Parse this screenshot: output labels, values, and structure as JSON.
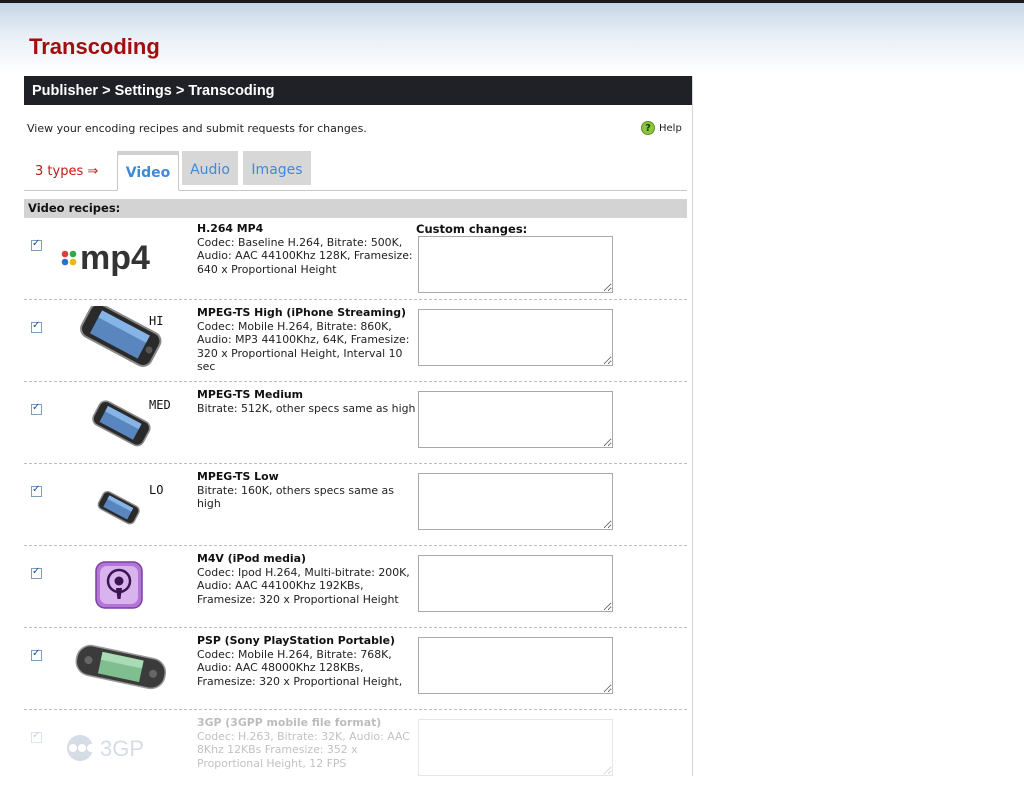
{
  "page": {
    "title": "Transcoding",
    "breadcrumb": "Publisher > Settings > Transcoding",
    "intro": "View your encoding recipes and submit requests for changes.",
    "help_label": "Help"
  },
  "tabs": {
    "types_label": "3 types ⇒",
    "items": [
      {
        "label": "Video",
        "active": true
      },
      {
        "label": "Audio",
        "active": false
      },
      {
        "label": "Images",
        "active": false
      }
    ]
  },
  "section": {
    "header": "Video recipes:",
    "custom_label": "Custom changes:"
  },
  "recipes": [
    {
      "name": "H.264 MP4",
      "spec": "Codec: Baseline H.264, Bitrate: 500K, Audio: AAC 44100Khz 128K, Framesize: 640 x Proportional Height",
      "icon": "mp4-logo",
      "logo_text": "mp4",
      "checked": true,
      "custom": ""
    },
    {
      "name": "MPEG-TS High (iPhone Streaming)",
      "spec": "Codec: Mobile H.264, Bitrate: 860K, Audio: MP3 44100Khz, 64K, Framesize: 320 x Proportional Height, Interval 10 sec",
      "icon": "iphone-large",
      "size_label": "HI",
      "checked": true,
      "custom": ""
    },
    {
      "name": "MPEG-TS Medium",
      "spec": "Bitrate: 512K, other specs same as high",
      "icon": "iphone-medium",
      "size_label": "MED",
      "checked": true,
      "custom": ""
    },
    {
      "name": "MPEG-TS Low",
      "spec": "Bitrate: 160K, others specs same as high",
      "icon": "iphone-small",
      "size_label": "LO",
      "checked": true,
      "custom": ""
    },
    {
      "name": "M4V (iPod media)",
      "spec": "Codec: Ipod H.264, Multi-bitrate: 200K, Audio: AAC 44100Khz 192KBs, Framesize: 320 x Proportional Height",
      "icon": "podcast-icon",
      "checked": true,
      "custom": ""
    },
    {
      "name": "PSP (Sony PlayStation Portable)",
      "spec": "Codec: Mobile H.264, Bitrate: 768K, Audio: AAC 48000Khz 128KBs, Framesize: 320 x Proportional Height,",
      "icon": "psp-icon",
      "checked": true,
      "custom": ""
    },
    {
      "name": "3GP (3GPP mobile file format)",
      "spec": "Codec: H.263, Bitrate: 32K, Audio: AAC 8Khz 12KBs Framesize: 352 x Proportional Height, 12 FPS",
      "icon": "3gp-logo",
      "logo_text": "3GP",
      "checked": true,
      "custom": ""
    }
  ],
  "colors": {
    "title": "#a00e0e",
    "breadcrumb_bg": "#1f2126",
    "tab_text": "#3f89d8",
    "types_text": "#c01818"
  }
}
